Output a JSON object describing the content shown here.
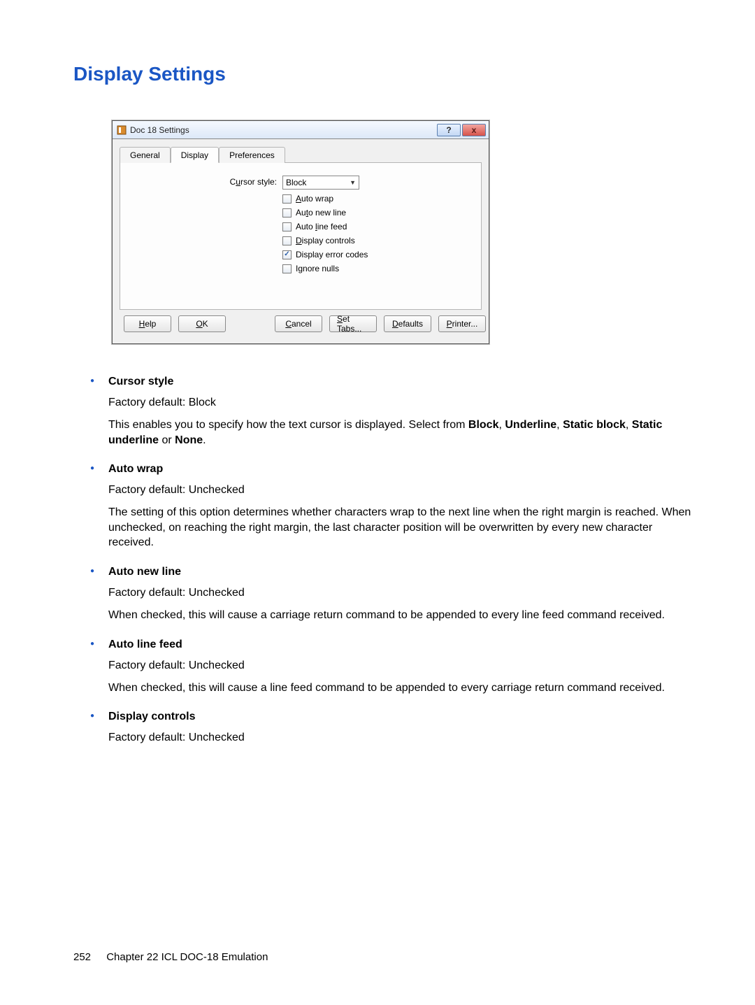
{
  "heading": "Display Settings",
  "dialog": {
    "title": "Doc 18 Settings",
    "tabs": {
      "general": "General",
      "display": "Display",
      "preferences": "Preferences"
    },
    "cursor_label_pre": "C",
    "cursor_label_u": "u",
    "cursor_label_post": "rsor style:",
    "cursor_value": "Block",
    "cb": {
      "autowrap_pre": "",
      "autowrap_u": "A",
      "autowrap_post": "uto wrap",
      "autonewline_pre": "Au",
      "autonewline_u": "t",
      "autonewline_post": "o new line",
      "autolinefeed_pre": "Auto ",
      "autolinefeed_u": "l",
      "autolinefeed_post": "ine feed",
      "displaycontrols_pre": "",
      "displaycontrols_u": "D",
      "displaycontrols_post": "isplay controls",
      "displayerrors": "Display error codes",
      "ignorenulls_pre": "I",
      "ignorenulls_u": "g",
      "ignorenulls_post": "nore nulls"
    },
    "buttons": {
      "help_u": "H",
      "help_post": "elp",
      "ok_u": "O",
      "ok_post": "K",
      "cancel_u": "C",
      "cancel_post": "ancel",
      "settabs_u": "S",
      "settabs_post": "et Tabs...",
      "defaults_u": "D",
      "defaults_post": "efaults",
      "printer_u": "P",
      "printer_post": "rinter..."
    }
  },
  "items": {
    "cursor": {
      "title": "Cursor style",
      "default": "Factory default: Block",
      "desc_pre": "This enables you to specify how the text cursor is displayed. Select from ",
      "b1": "Block",
      "c1": ", ",
      "b2": "Underline",
      "c2": ", ",
      "b3": "Static block",
      "c3": ", ",
      "b4": "Static underline",
      "c4": " or ",
      "b5": "None",
      "c5": "."
    },
    "autowrap": {
      "title": "Auto wrap",
      "default": "Factory default: Unchecked",
      "desc": "The setting of this option determines whether characters wrap to the next line when the right margin is reached. When unchecked, on reaching the right margin, the last character position will be overwritten by every new character received."
    },
    "autonewline": {
      "title": "Auto new line",
      "default": "Factory default: Unchecked",
      "desc": "When checked, this will cause a carriage return command to be appended to every line feed command received."
    },
    "autolinefeed": {
      "title": "Auto line feed",
      "default": "Factory default: Unchecked",
      "desc": "When checked, this will cause a line feed command to be appended to every carriage return command received."
    },
    "displaycontrols": {
      "title": "Display controls",
      "default": "Factory default: Unchecked"
    }
  },
  "footer": {
    "page": "252",
    "chapter": "Chapter 22   ICL DOC-18 Emulation"
  }
}
